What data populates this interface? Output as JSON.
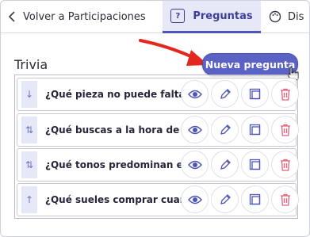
{
  "nav": {
    "back_label": "Volver a Participaciones",
    "active_tab": "Preguntas",
    "active_tab_icon": "question-box-icon",
    "next_tab": "Dis"
  },
  "section": {
    "title": "Trivia",
    "new_button": "Nueva pregunta"
  },
  "questions": [
    {
      "handle": "↓",
      "text": "¿Qué pieza no puede faltar"
    },
    {
      "handle": "⇅",
      "text": "¿Qué buscas a la hora de co"
    },
    {
      "handle": "⇅",
      "text": "¿Qué tonos predominan en"
    },
    {
      "handle": "↑",
      "text": "¿Qué sueles comprar cuand"
    }
  ],
  "colors": {
    "accent": "#5b62c6",
    "active_tab_bg": "#e7e8f7",
    "delete": "#e0607a",
    "arrow": "#e3261e"
  }
}
